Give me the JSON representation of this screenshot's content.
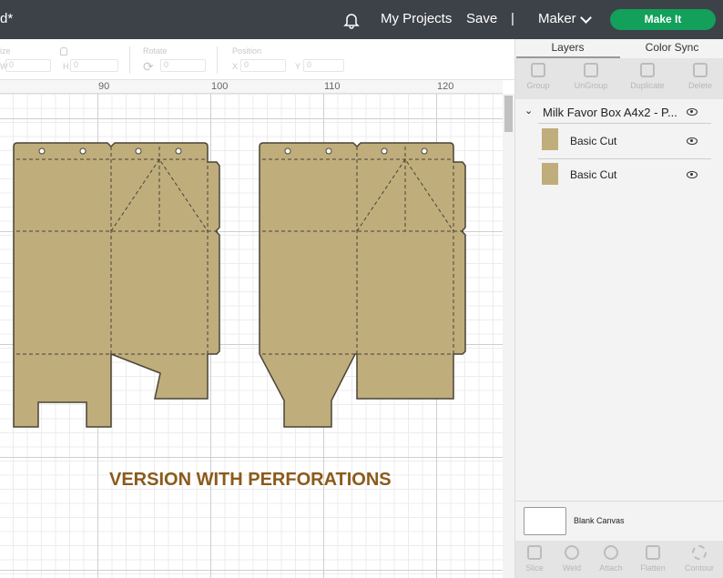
{
  "header": {
    "title": "d*",
    "notifications_icon": "bell-icon",
    "my_projects": "My Projects",
    "save": "Save",
    "separator": "|",
    "machine": "Maker",
    "make_it": "Make It"
  },
  "toolbar": {
    "size_label": "ize",
    "w_label": "W",
    "h_label": "H",
    "w_value": "0",
    "h_value": "0",
    "rotate_label": "Rotate",
    "rotate_value": "0",
    "position_label": "Position",
    "x_label": "X",
    "y_label": "Y",
    "x_value": "0",
    "y_value": "0"
  },
  "ruler": {
    "ticks": [
      "90",
      "100",
      "110",
      "120"
    ]
  },
  "canvas": {
    "banner": "VERSION WITH PERFORATIONS",
    "fill_color": "#bfad7c",
    "outline_color": "#4a4436"
  },
  "panel": {
    "tabs": [
      "Layers",
      "Color Sync"
    ],
    "actions": [
      "Group",
      "UnGroup",
      "Duplicate",
      "Delete"
    ],
    "group_name": "Milk Favor Box A4x2 - P...",
    "layers": [
      {
        "name": "Basic Cut"
      },
      {
        "name": "Basic Cut"
      }
    ],
    "canvas_label": "Blank Canvas",
    "bottom_actions": [
      "Slice",
      "Weld",
      "Attach",
      "Flatten",
      "Contour"
    ]
  }
}
